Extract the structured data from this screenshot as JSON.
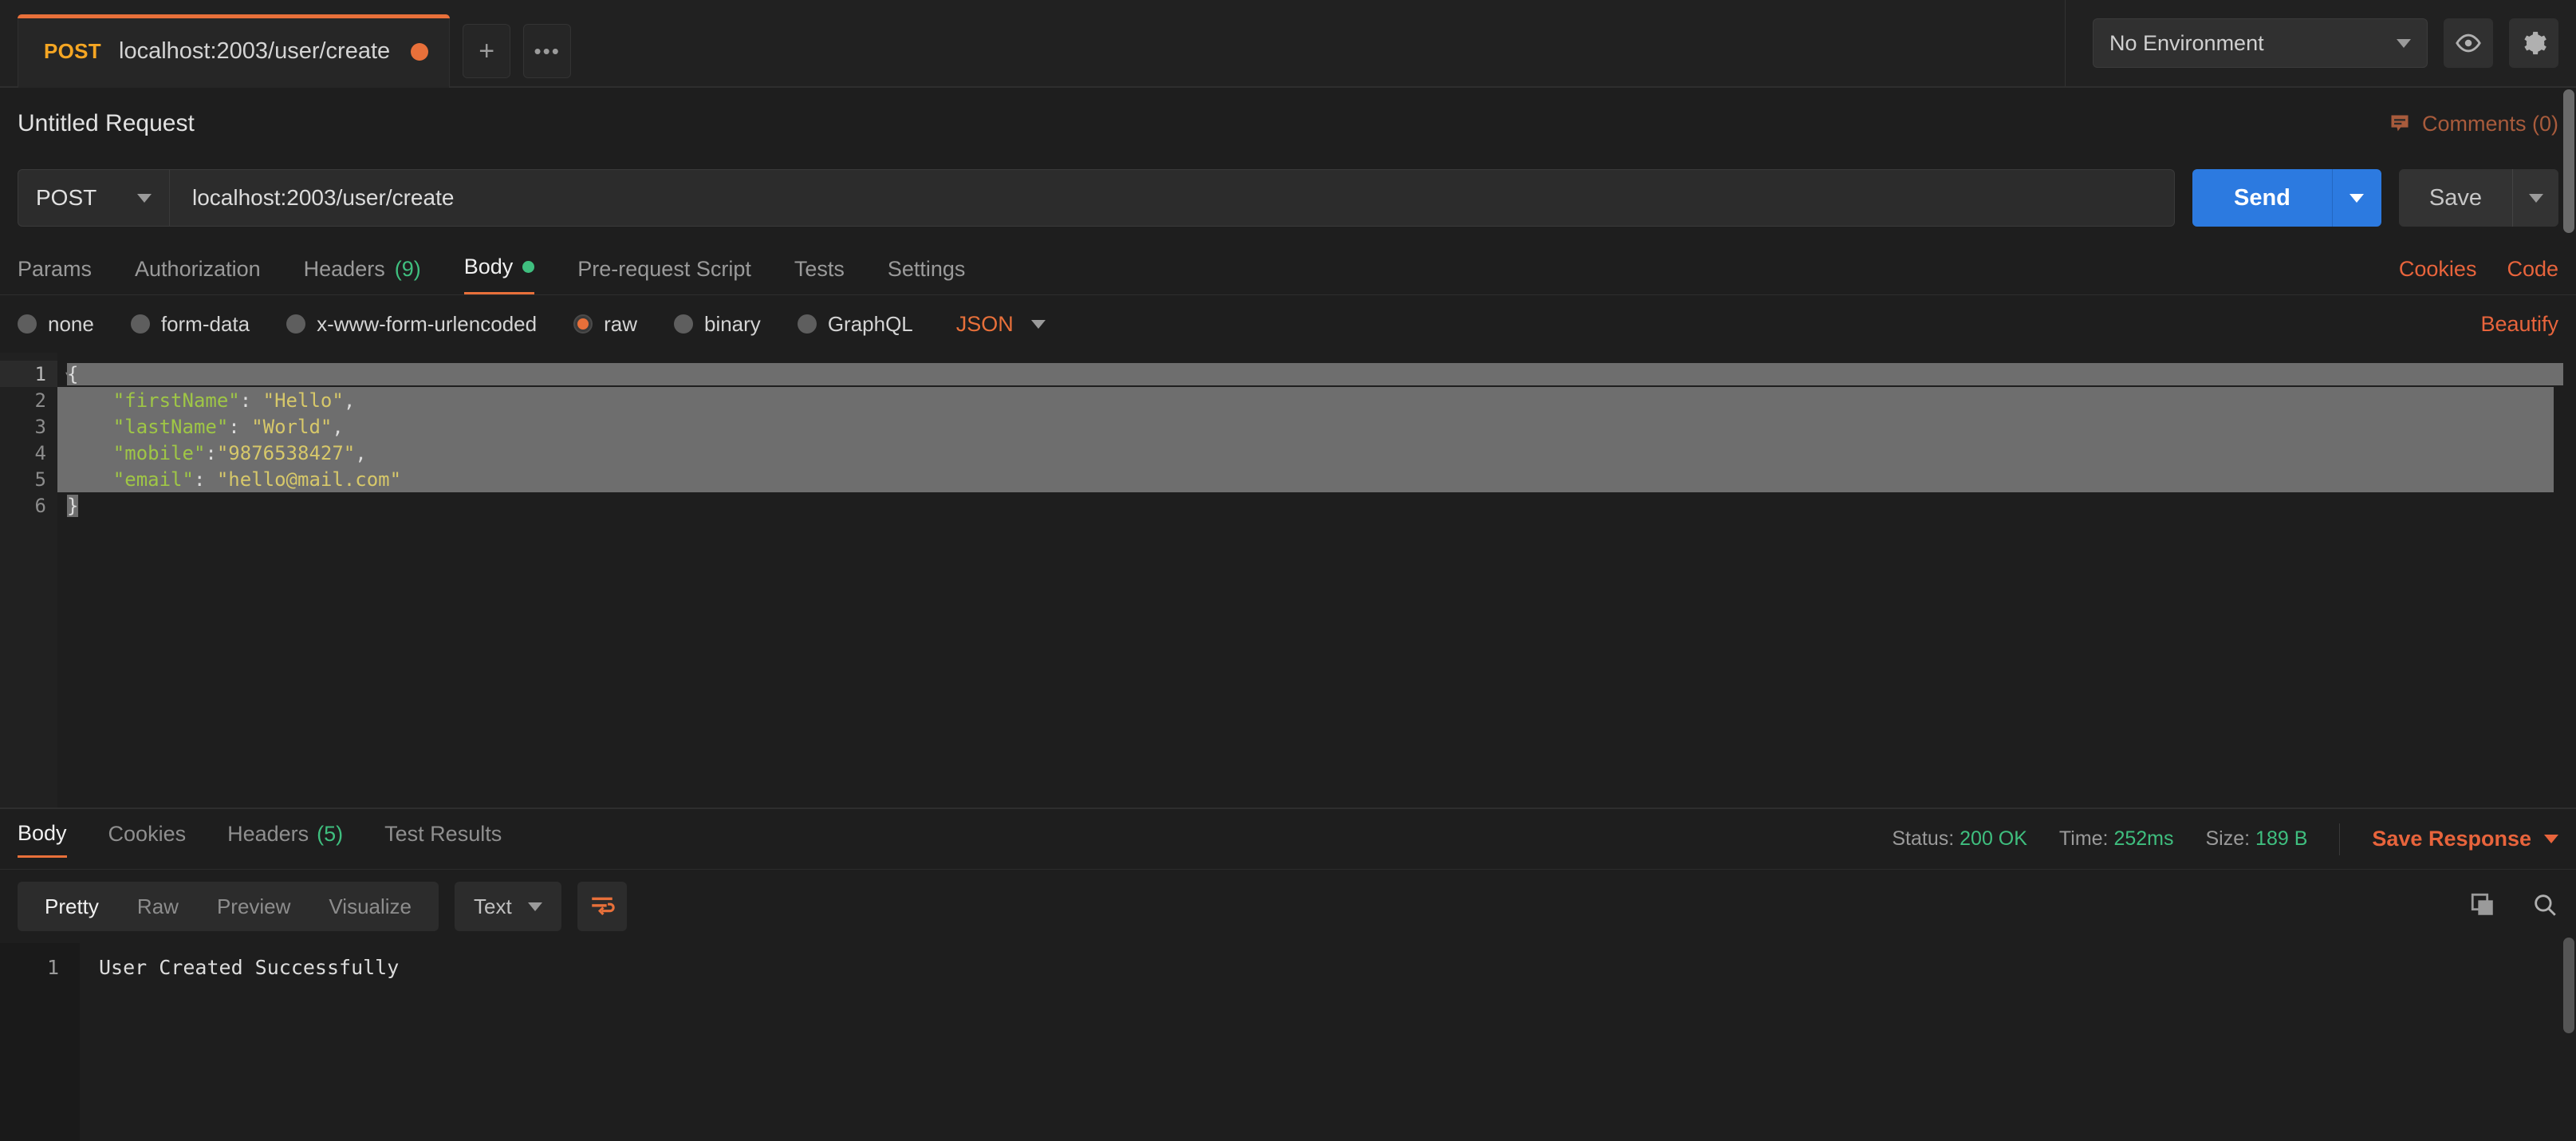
{
  "tabbar": {
    "tab": {
      "method": "POST",
      "title": "localhost:2003/user/create"
    },
    "new_tab_label": "+",
    "more_label": "•••"
  },
  "environment": {
    "selected": "No Environment",
    "eye_icon": "eye-icon",
    "gear_icon": "gear-icon"
  },
  "request": {
    "title": "Untitled Request",
    "comments_label": "Comments (0)",
    "method": "POST",
    "url": "localhost:2003/user/create",
    "send_label": "Send",
    "save_label": "Save",
    "tabs": [
      {
        "label": "Params",
        "count": "",
        "active": false
      },
      {
        "label": "Authorization",
        "count": "",
        "active": false
      },
      {
        "label": "Headers",
        "count": "(9)",
        "active": false
      },
      {
        "label": "Body",
        "count": "",
        "active": true
      },
      {
        "label": "Pre-request Script",
        "count": "",
        "active": false
      },
      {
        "label": "Tests",
        "count": "",
        "active": false
      },
      {
        "label": "Settings",
        "count": "",
        "active": false
      }
    ],
    "right_links": [
      "Cookies",
      "Code"
    ],
    "body_types": [
      {
        "label": "none",
        "selected": false
      },
      {
        "label": "form-data",
        "selected": false
      },
      {
        "label": "x-www-form-urlencoded",
        "selected": false
      },
      {
        "label": "raw",
        "selected": true
      },
      {
        "label": "binary",
        "selected": false
      },
      {
        "label": "GraphQL",
        "selected": false
      }
    ],
    "raw_format": "JSON",
    "beautify_label": "Beautify"
  },
  "editor": {
    "lines": [
      {
        "n": "1",
        "indent": "",
        "text": "{",
        "kind": "punct"
      },
      {
        "n": "2",
        "indent": "    ",
        "key": "\"firstName\"",
        "sep": ": ",
        "value": "\"Hello\"",
        "tail": ","
      },
      {
        "n": "3",
        "indent": "    ",
        "key": "\"lastName\"",
        "sep": ": ",
        "value": "\"World\"",
        "tail": ","
      },
      {
        "n": "4",
        "indent": "    ",
        "key": "\"mobile\"",
        "sep": ":",
        "value": "\"9876538427\"",
        "tail": ","
      },
      {
        "n": "5",
        "indent": "    ",
        "key": "\"email\"",
        "sep": ": ",
        "value": "\"hello@mail.com\"",
        "tail": ""
      },
      {
        "n": "6",
        "indent": "",
        "text": "}",
        "kind": "punct"
      }
    ]
  },
  "response": {
    "tabs": [
      {
        "label": "Body",
        "count": "",
        "active": true
      },
      {
        "label": "Cookies",
        "count": "",
        "active": false
      },
      {
        "label": "Headers",
        "count": "(5)",
        "active": false
      },
      {
        "label": "Test Results",
        "count": "",
        "active": false
      }
    ],
    "status_label": "Status:",
    "status_value": "200 OK",
    "time_label": "Time:",
    "time_value": "252ms",
    "size_label": "Size:",
    "size_value": "189 B",
    "save_response_label": "Save Response",
    "view_modes": [
      {
        "label": "Pretty",
        "active": true
      },
      {
        "label": "Raw",
        "active": false
      },
      {
        "label": "Preview",
        "active": false
      },
      {
        "label": "Visualize",
        "active": false
      }
    ],
    "format": "Text",
    "wrap_icon": "word-wrap-icon",
    "copy_icon": "copy-icon",
    "search_icon": "search-icon",
    "body_lines": [
      {
        "n": "1",
        "text": "User Created Successfully"
      }
    ]
  },
  "colors": {
    "accent_orange": "#e8703a",
    "send_blue": "#2c7ae0",
    "green": "#3fbf7f",
    "json_key": "#9fc646",
    "json_value": "#d7c86a"
  }
}
